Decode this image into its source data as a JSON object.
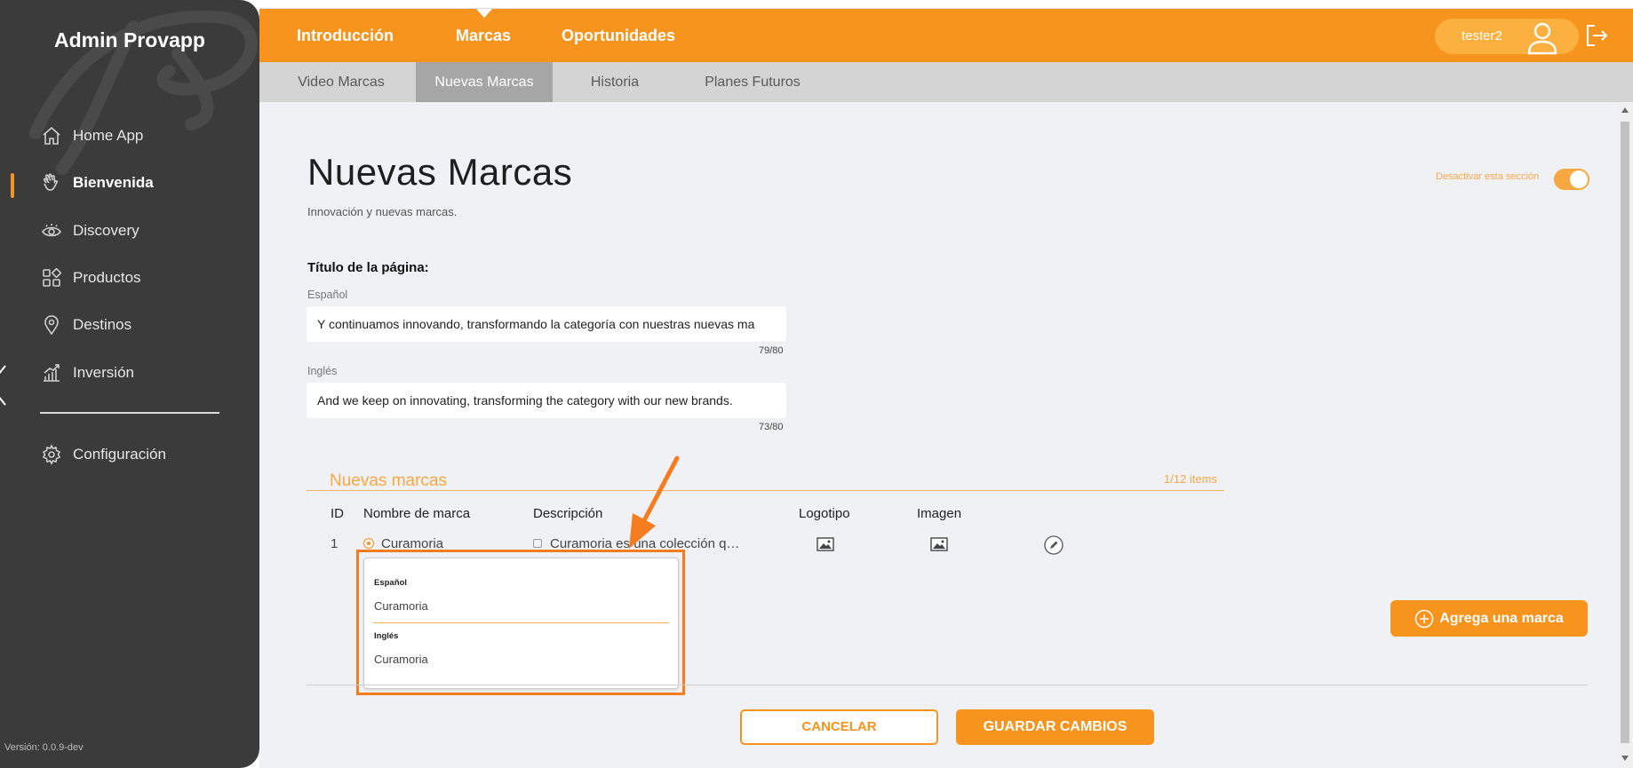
{
  "sidebar": {
    "brand": "Admin Provapp",
    "items": [
      {
        "label": "Home App",
        "icon": "home-icon"
      },
      {
        "label": "Bienvenida",
        "icon": "wave-hand-icon",
        "active": true
      },
      {
        "label": "Discovery",
        "icon": "eye-icon"
      },
      {
        "label": "Productos",
        "icon": "grid-icon"
      },
      {
        "label": "Destinos",
        "icon": "location-pin-icon"
      },
      {
        "label": "Inversión",
        "icon": "chart-growth-icon"
      },
      {
        "label": "Configuración",
        "icon": "gear-icon"
      }
    ],
    "version": "Versión: 0.0.9-dev"
  },
  "topnav": {
    "tabs": [
      "Introducción",
      "Marcas",
      "Oportunidades"
    ],
    "active_tab": "Marcas",
    "username": "tester2"
  },
  "subnav": {
    "tabs": [
      "Video Marcas",
      "Nuevas Marcas",
      "Historia",
      "Planes Futuros"
    ],
    "active_tab": "Nuevas Marcas"
  },
  "page": {
    "title": "Nuevas Marcas",
    "subtitle": "Innovación y nuevas marcas.",
    "toggle_label": "Desactivar esta sección",
    "section_label": "Título de la página:",
    "es_label": "Español",
    "es_value": "Y continuamos innovando, transformando la categoría con nuestras nuevas ma",
    "es_counter": "79/80",
    "en_label": "Inglés",
    "en_value": "And we keep on innovating, transforming the category with our new brands.",
    "en_counter": "73/80"
  },
  "brands": {
    "title": "Nuevas marcas",
    "count": "1/12 items",
    "columns": [
      "ID",
      "Nombre de marca",
      "Descripción",
      "Logotipo",
      "Imagen"
    ],
    "rows": [
      {
        "id": "1",
        "name": "Curamoria",
        "description": "Curamoria es una colección q…"
      }
    ],
    "popover": {
      "es_label": "Español",
      "es_value": "Curamoria",
      "en_label": "Inglés",
      "en_value": "Curamoria"
    },
    "add_label": "Agrega una marca"
  },
  "actions": {
    "cancel": "CANCELAR",
    "save": "GUARDAR CAMBIOS"
  },
  "colors": {
    "accent": "#f7941d",
    "sidebar": "#3b3b3b",
    "highlight": "#f57c1f"
  }
}
